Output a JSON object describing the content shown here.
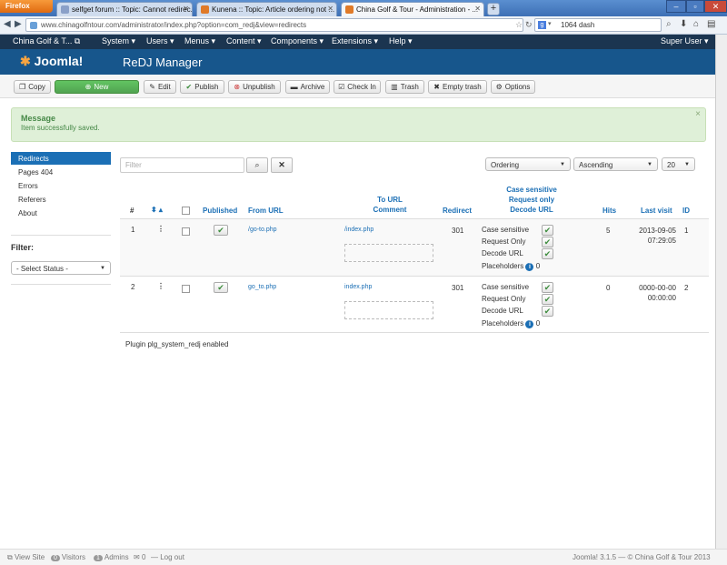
{
  "browser": {
    "app_button": "Firefox",
    "tabs": [
      {
        "label": "selfget forum :: Topic: Cannot redirec..."
      },
      {
        "label": "Kunena :: Topic: Article ordering not ..."
      },
      {
        "label": "China Golf & Tour - Administration - ..."
      }
    ],
    "url": "www.chinagolfntour.com/administrator/index.php?option=com_redj&view=redirects",
    "search_value": "1064 dash"
  },
  "menu": {
    "site_name": "China Golf & T...",
    "items": [
      "System",
      "Users",
      "Menus",
      "Content",
      "Components",
      "Extensions",
      "Help"
    ],
    "user": "Super User"
  },
  "header": {
    "logo": "Joomla!",
    "title": "ReDJ Manager"
  },
  "toolbar": {
    "copy": "Copy",
    "new": "New",
    "edit": "Edit",
    "publish": "Publish",
    "unpublish": "Unpublish",
    "archive": "Archive",
    "checkin": "Check In",
    "trash": "Trash",
    "empty_trash": "Empty trash",
    "options": "Options"
  },
  "message": {
    "title": "Message",
    "text": "Item successfully saved.",
    "close": "×"
  },
  "sidebar": {
    "items": [
      {
        "label": "Redirects"
      },
      {
        "label": "Pages 404"
      },
      {
        "label": "Errors"
      },
      {
        "label": "Referers"
      },
      {
        "label": "About"
      }
    ],
    "filter_heading": "Filter:",
    "status_select": "- Select Status -"
  },
  "filters": {
    "placeholder": "Filter",
    "ordering": "Ordering",
    "direction": "Ascending",
    "limit": "20"
  },
  "table": {
    "headers": {
      "num": "#",
      "published": "Published",
      "from_url": "From URL",
      "to_url": "To URL",
      "comment": "Comment",
      "redirect": "Redirect",
      "case_sensitive": "Case sensitive",
      "request_only": "Request only",
      "decode_url": "Decode URL",
      "hits": "Hits",
      "last_visit": "Last visit",
      "id": "ID"
    },
    "option_labels": {
      "case_sensitive": "Case sensitive",
      "request_only": "Request Only",
      "decode_url": "Decode URL",
      "placeholders": "Placeholders"
    },
    "rows": [
      {
        "num": "1",
        "from_url": "/go-to.php",
        "to_url": "/index.php",
        "redirect": "301",
        "placeholders": "0",
        "hits": "5",
        "last_visit_date": "2013-09-05",
        "last_visit_time": "07:29:05",
        "id": "1"
      },
      {
        "num": "2",
        "from_url": "go_to.php",
        "to_url": "index.php",
        "redirect": "301",
        "placeholders": "0",
        "hits": "0",
        "last_visit_date": "0000-00-00",
        "last_visit_time": "00:00:00",
        "id": "2"
      }
    ]
  },
  "plugin_notice": "Plugin plg_system_redj enabled",
  "statusbar": {
    "view_site": "View Site",
    "visitors_count": "0",
    "visitors": "Visitors",
    "admins_count": "1",
    "admins": "Admins",
    "messages_count": "0",
    "logout": "Log out",
    "version": "Joomla! 3.1.5 — © China Golf & Tour 2013"
  }
}
